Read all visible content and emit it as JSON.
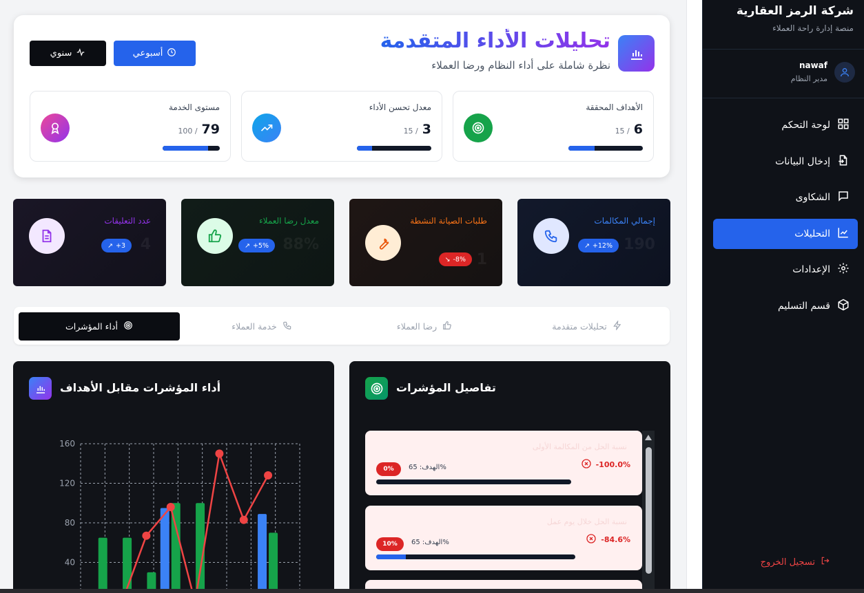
{
  "sidebar": {
    "company": "شركة الرمز العقارية",
    "tagline": "منصة إدارة راحة العملاء",
    "user": {
      "name": "nawaf",
      "role": "مدير النظام"
    },
    "items": [
      {
        "label": "لوحة التحكم",
        "icon": "dashboard-icon",
        "active": false
      },
      {
        "label": "إدخال البيانات",
        "icon": "data-entry-icon",
        "active": false
      },
      {
        "label": "الشكاوى",
        "icon": "complaints-icon",
        "active": false
      },
      {
        "label": "التحليلات",
        "icon": "analytics-icon",
        "active": true
      },
      {
        "label": "الإعدادات",
        "icon": "settings-icon",
        "active": false
      },
      {
        "label": "قسم التسليم",
        "icon": "delivery-icon",
        "active": false
      }
    ],
    "logout": "تسجيل الخروج"
  },
  "header": {
    "title": "تحليلات الأداء المتقدمة",
    "subtitle": "نظرة شاملة على أداء النظام ورضا العملاء",
    "btn_weekly": "أسبوعي",
    "btn_yearly": "سنوي"
  },
  "stats": [
    {
      "label": "الأهداف المحققة",
      "value": "6",
      "total": "15 /",
      "fraction": 0.35,
      "color": "#16a34a",
      "icon": "target-icon"
    },
    {
      "label": "معدل تحسن الأداء",
      "value": "3",
      "total": "15 /",
      "fraction": 0.2,
      "color": "#3b82f6",
      "icon": "trending-up-icon"
    },
    {
      "label": "مستوى الخدمة",
      "value": "79",
      "total": "100 /",
      "fraction": 0.79,
      "color": "#c026d3",
      "icon": "award-icon"
    }
  ],
  "kpis": [
    {
      "label": "إجمالي المكالمات",
      "value": "190",
      "badge": "+12%",
      "badge_color": "#2563eb",
      "label_color": "#3b82f6",
      "icon": "phone-icon"
    },
    {
      "label": "طلبات الصيانة النشطة",
      "value": "1",
      "badge": "-8%",
      "badge_color": "#dc2626",
      "label_color": "#f97316",
      "icon": "wrench-icon"
    },
    {
      "label": "معدل رضا العملاء",
      "value": "88%",
      "badge": "+5%",
      "badge_color": "#2563eb",
      "label_color": "#16a34a",
      "icon": "thumbs-up-icon"
    },
    {
      "label": "عدد التعليقات",
      "value": "4",
      "badge": "+3",
      "badge_color": "#2563eb",
      "label_color": "#9333ea",
      "icon": "document-icon"
    }
  ],
  "tabs": [
    {
      "label": "تحليلات متقدمة",
      "icon": "bolt-icon",
      "active": false
    },
    {
      "label": "رضا العملاء",
      "icon": "thumbs-up-icon",
      "active": false
    },
    {
      "label": "خدمة العملاء",
      "icon": "phone-icon",
      "active": false
    },
    {
      "label": "أداء المؤشرات",
      "icon": "target-icon",
      "active": true
    }
  ],
  "details": {
    "title": "تفاصيل المؤشرات",
    "items": [
      {
        "name": "نسبة الحل من المكالمة الأولى",
        "pct": "0%",
        "target": "65 :الهدف%",
        "delta": "-100.0%",
        "progress": 0.0
      },
      {
        "name": "نسبة الحل خلال يوم عمل",
        "pct": "10%",
        "target": "65 :الهدف%",
        "delta": "-84.6%",
        "progress": 0.15
      }
    ]
  },
  "chart_panel": {
    "title": "أداء المؤشرات مقابل الأهداف"
  },
  "chart_data": {
    "type": "bar",
    "title": "أداء المؤشرات مقابل الأهداف",
    "y_ticks": [
      "160",
      "120",
      "80",
      "40"
    ],
    "ylim": [
      0,
      160
    ],
    "grid": true,
    "series": [
      {
        "values": [
          0,
          0,
          6,
          95,
          0,
          0,
          0,
          89
        ],
        "color": "#3b82f6"
      },
      {
        "values": [
          65,
          65,
          30,
          100,
          100,
          0,
          0,
          70
        ],
        "color": "#16a34a"
      },
      {
        "values": [
          0,
          0,
          67,
          96,
          0,
          150,
          83,
          128
        ],
        "color": "#ef4444"
      }
    ]
  }
}
